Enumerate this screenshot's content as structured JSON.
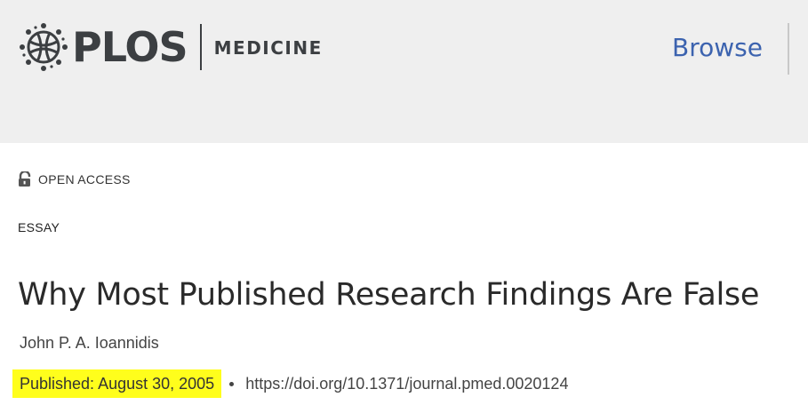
{
  "header": {
    "logo": {
      "brand": "PLOS",
      "journal": "MEDICINE",
      "icon": "plos-globe-logo-icon"
    },
    "nav": {
      "browse_label": "Browse"
    }
  },
  "article": {
    "access": {
      "icon": "unlocked-padlock-icon",
      "label": "OPEN ACCESS"
    },
    "type": "ESSAY",
    "title": "Why Most Published Research Findings Are False",
    "author": "John P. A. Ioannidis",
    "published": "Published: August 30, 2005",
    "doi": "https://doi.org/10.1371/journal.pmed.0020124"
  },
  "colors": {
    "header_bg": "#efefef",
    "brand_text": "#3c3f42",
    "link_blue": "#3c63af",
    "highlight": "#fffe1c"
  }
}
